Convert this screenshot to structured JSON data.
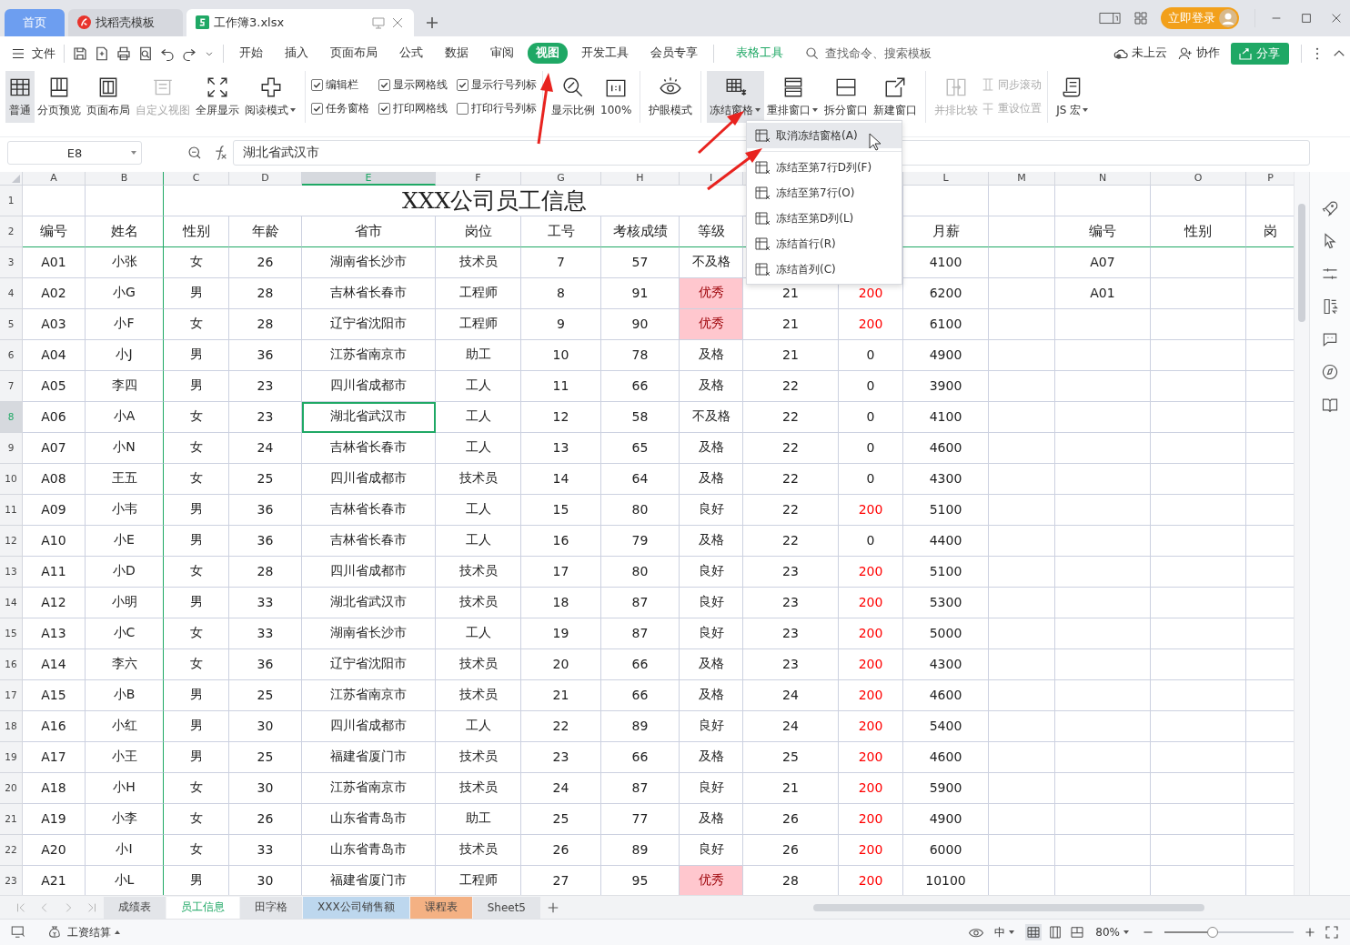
{
  "top_tabs": [
    {
      "label": "首页",
      "kind": "home",
      "selected": false
    },
    {
      "label": "找稻壳模板",
      "kind": "docer",
      "selected": false
    },
    {
      "label": "工作簿3.xlsx",
      "kind": "sheet",
      "selected": true
    }
  ],
  "login": "立即登录",
  "file_menu": "文件",
  "menu_tabs": [
    {
      "label": "开始",
      "selected": false
    },
    {
      "label": "插入",
      "selected": false
    },
    {
      "label": "页面布局",
      "selected": false
    },
    {
      "label": "公式",
      "selected": false
    },
    {
      "label": "数据",
      "selected": false
    },
    {
      "label": "审阅",
      "selected": false
    },
    {
      "label": "视图",
      "selected": true
    },
    {
      "label": "开发工具",
      "selected": false
    },
    {
      "label": "会员专享",
      "selected": false
    }
  ],
  "context_tab": "表格工具",
  "search": {
    "placeholder": "查找命令、搜索模板"
  },
  "cloud": "未上云",
  "collab": "协作",
  "share": "分享",
  "ribbon_groups": [
    [
      {
        "kind": "large",
        "label": "普通",
        "selected": true,
        "disabled": false,
        "dropdown": false
      },
      {
        "kind": "large",
        "label": "分页预览",
        "selected": false,
        "disabled": false,
        "dropdown": false
      },
      {
        "kind": "large",
        "label": "页面布局",
        "selected": false,
        "disabled": false,
        "dropdown": false
      },
      {
        "kind": "large",
        "label": "自定义视图",
        "selected": false,
        "disabled": true,
        "dropdown": false
      },
      {
        "kind": "large",
        "label": "全屏显示",
        "selected": false,
        "disabled": false,
        "dropdown": false
      },
      {
        "kind": "large",
        "label": "阅读模式",
        "selected": false,
        "disabled": false,
        "dropdown": true
      }
    ],
    [
      {
        "kind": "check",
        "label": "编辑栏",
        "checked": true
      },
      {
        "kind": "check",
        "label": "任务窗格",
        "checked": true
      },
      {
        "kind": "check",
        "label": "显示网格线",
        "checked": true
      },
      {
        "kind": "check",
        "label": "打印网格线",
        "checked": true
      },
      {
        "kind": "check",
        "label": "显示行号列标",
        "checked": true
      },
      {
        "kind": "check",
        "label": "打印行号列标",
        "checked": false
      }
    ],
    [
      {
        "kind": "large",
        "label": "显示比例",
        "selected": false,
        "disabled": false,
        "dropdown": false
      },
      {
        "kind": "large",
        "label": "100%",
        "selected": false,
        "disabled": false,
        "dropdown": false
      }
    ],
    [
      {
        "kind": "large",
        "label": "护眼模式",
        "selected": false,
        "disabled": false,
        "dropdown": false
      }
    ],
    [
      {
        "kind": "large",
        "label": "冻结窗格",
        "selected": true,
        "disabled": false,
        "dropdown": true
      },
      {
        "kind": "large",
        "label": "重排窗口",
        "selected": false,
        "disabled": false,
        "dropdown": true
      },
      {
        "kind": "large",
        "label": "拆分窗口",
        "selected": false,
        "disabled": false,
        "dropdown": false
      },
      {
        "kind": "large",
        "label": "新建窗口",
        "selected": false,
        "disabled": false,
        "dropdown": false
      }
    ],
    [
      {
        "kind": "large",
        "label": "并排比较",
        "selected": false,
        "disabled": true,
        "dropdown": false
      },
      {
        "kind": "small",
        "label": "同步滚动",
        "disabled": true
      },
      {
        "kind": "small",
        "label": "重设位置",
        "disabled": true
      }
    ],
    [
      {
        "kind": "large",
        "label": "JS 宏",
        "selected": false,
        "disabled": false,
        "dropdown": true
      }
    ]
  ],
  "name_box": "E8",
  "formula": "湖北省武汉市",
  "columns": [
    {
      "label": "A",
      "selected": false
    },
    {
      "label": "B",
      "selected": false
    },
    {
      "label": "C",
      "selected": false
    },
    {
      "label": "D",
      "selected": false
    },
    {
      "label": "E",
      "selected": true
    },
    {
      "label": "F",
      "selected": false
    },
    {
      "label": "G",
      "selected": false
    },
    {
      "label": "H",
      "selected": false
    },
    {
      "label": "I",
      "selected": false
    },
    null,
    null,
    {
      "label": "L",
      "selected": false
    },
    {
      "label": "M",
      "selected": false
    },
    {
      "label": "N",
      "selected": false
    },
    {
      "label": "O",
      "selected": false
    },
    {
      "label": "P",
      "selected": false
    }
  ],
  "rows": [
    {
      "row": "1",
      "title": "XXX公司员工信息",
      "selected": false
    },
    {
      "row": "2",
      "selected": false,
      "cells": [
        "编号",
        "姓名",
        "性别",
        "年龄",
        "省市",
        "岗位",
        "工号",
        "考核成绩",
        "等级",
        null,
        null,
        "月薪",
        null,
        "编号",
        "性别",
        "岗"
      ]
    },
    {
      "row": "3",
      "selected": false,
      "excellent": false,
      "cells": [
        "A01",
        "小张",
        "女",
        "26",
        "湖南省长沙市",
        "技术员",
        "7",
        "57",
        "不及格",
        null,
        null,
        "4100",
        null,
        "A07"
      ]
    },
    {
      "row": "4",
      "selected": false,
      "excellent": true,
      "bonus_red": true,
      "cells": [
        "A02",
        "小G",
        "男",
        "28",
        "吉林省长春市",
        "工程师",
        "8",
        "91",
        "优秀",
        "21",
        "200",
        "6200",
        null,
        "A01"
      ]
    },
    {
      "row": "5",
      "selected": false,
      "excellent": true,
      "bonus_red": true,
      "cells": [
        "A03",
        "小F",
        "女",
        "28",
        "辽宁省沈阳市",
        "工程师",
        "9",
        "90",
        "优秀",
        "21",
        "200",
        "6100"
      ]
    },
    {
      "row": "6",
      "selected": false,
      "excellent": false,
      "bonus_red": false,
      "cells": [
        "A04",
        "小J",
        "男",
        "36",
        "江苏省南京市",
        "助工",
        "10",
        "78",
        "及格",
        "21",
        "0",
        "4900"
      ]
    },
    {
      "row": "7",
      "selected": false,
      "excellent": false,
      "bonus_red": false,
      "cells": [
        "A05",
        "李四",
        "男",
        "23",
        "四川省成都市",
        "工人",
        "11",
        "66",
        "及格",
        "22",
        "0",
        "3900"
      ]
    },
    {
      "row": "8",
      "selected": true,
      "excellent": false,
      "bonus_red": false,
      "cells": [
        "A06",
        "小A",
        "女",
        "23",
        "湖北省武汉市",
        "工人",
        "12",
        "58",
        "不及格",
        "22",
        "0",
        "4100"
      ]
    },
    {
      "row": "9",
      "selected": false,
      "excellent": false,
      "bonus_red": false,
      "cells": [
        "A07",
        "小N",
        "女",
        "24",
        "吉林省长春市",
        "工人",
        "13",
        "65",
        "及格",
        "22",
        "0",
        "4600"
      ]
    },
    {
      "row": "10",
      "selected": false,
      "excellent": false,
      "bonus_red": false,
      "cells": [
        "A08",
        "王五",
        "女",
        "25",
        "四川省成都市",
        "技术员",
        "14",
        "64",
        "及格",
        "22",
        "0",
        "4300"
      ]
    },
    {
      "row": "11",
      "selected": false,
      "excellent": false,
      "bonus_red": true,
      "cells": [
        "A09",
        "小韦",
        "男",
        "36",
        "吉林省长春市",
        "工人",
        "15",
        "80",
        "良好",
        "22",
        "200",
        "5100"
      ]
    },
    {
      "row": "12",
      "selected": false,
      "excellent": false,
      "bonus_red": false,
      "cells": [
        "A10",
        "小E",
        "男",
        "36",
        "吉林省长春市",
        "工人",
        "16",
        "79",
        "及格",
        "22",
        "0",
        "4400"
      ]
    },
    {
      "row": "13",
      "selected": false,
      "excellent": false,
      "bonus_red": true,
      "cells": [
        "A11",
        "小D",
        "女",
        "28",
        "四川省成都市",
        "技术员",
        "17",
        "80",
        "良好",
        "23",
        "200",
        "5100"
      ]
    },
    {
      "row": "14",
      "selected": false,
      "excellent": false,
      "bonus_red": true,
      "cells": [
        "A12",
        "小明",
        "男",
        "33",
        "湖北省武汉市",
        "技术员",
        "18",
        "87",
        "良好",
        "23",
        "200",
        "5300"
      ]
    },
    {
      "row": "15",
      "selected": false,
      "excellent": false,
      "bonus_red": true,
      "cells": [
        "A13",
        "小C",
        "女",
        "33",
        "湖南省长沙市",
        "工人",
        "19",
        "87",
        "良好",
        "23",
        "200",
        "5000"
      ]
    },
    {
      "row": "16",
      "selected": false,
      "excellent": false,
      "bonus_red": true,
      "cells": [
        "A14",
        "李六",
        "女",
        "36",
        "辽宁省沈阳市",
        "技术员",
        "20",
        "66",
        "及格",
        "23",
        "200",
        "4300"
      ]
    },
    {
      "row": "17",
      "selected": false,
      "excellent": false,
      "bonus_red": true,
      "cells": [
        "A15",
        "小B",
        "男",
        "25",
        "江苏省南京市",
        "技术员",
        "21",
        "66",
        "及格",
        "24",
        "200",
        "4600"
      ]
    },
    {
      "row": "18",
      "selected": false,
      "excellent": false,
      "bonus_red": true,
      "cells": [
        "A16",
        "小红",
        "男",
        "30",
        "四川省成都市",
        "工人",
        "22",
        "89",
        "良好",
        "24",
        "200",
        "5400"
      ]
    },
    {
      "row": "19",
      "selected": false,
      "excellent": false,
      "bonus_red": true,
      "cells": [
        "A17",
        "小王",
        "男",
        "25",
        "福建省厦门市",
        "技术员",
        "23",
        "66",
        "及格",
        "25",
        "200",
        "4600"
      ]
    },
    {
      "row": "20",
      "selected": false,
      "excellent": false,
      "bonus_red": true,
      "cells": [
        "A18",
        "小H",
        "女",
        "30",
        "江苏省南京市",
        "技术员",
        "24",
        "87",
        "良好",
        "21",
        "200",
        "5900"
      ]
    },
    {
      "row": "21",
      "selected": false,
      "excellent": false,
      "bonus_red": true,
      "cells": [
        "A19",
        "小李",
        "女",
        "26",
        "山东省青岛市",
        "助工",
        "25",
        "77",
        "及格",
        "26",
        "200",
        "4900"
      ]
    },
    {
      "row": "22",
      "selected": false,
      "excellent": false,
      "bonus_red": true,
      "cells": [
        "A20",
        "小I",
        "女",
        "33",
        "山东省青岛市",
        "技术员",
        "26",
        "89",
        "良好",
        "26",
        "200",
        "6000"
      ]
    },
    {
      "row": "23",
      "selected": false,
      "excellent": true,
      "bonus_red": true,
      "cells": [
        "A21",
        "小L",
        "男",
        "30",
        "福建省厦门市",
        "工程师",
        "27",
        "95",
        "优秀",
        "28",
        "200",
        "10100"
      ]
    }
  ],
  "freeze_menu": [
    {
      "label": "取消冻结窗格(A)",
      "highlighted": true
    },
    {
      "label": "冻结至第7行D列(F)",
      "highlighted": false
    },
    {
      "label": "冻结至第7行(O)",
      "highlighted": false
    },
    {
      "label": "冻结至第D列(L)",
      "highlighted": false
    },
    {
      "label": "冻结首行(R)",
      "highlighted": false
    },
    {
      "label": "冻结首列(C)",
      "highlighted": false
    }
  ],
  "sheet_tabs": [
    {
      "label": "成绩表",
      "selected": false
    },
    {
      "label": "员工信息",
      "selected": true
    },
    {
      "label": "田字格",
      "selected": false
    },
    {
      "label": "XXX公司销售额",
      "selected": false,
      "color": "#bdd7ee"
    },
    {
      "label": "课程表",
      "selected": false,
      "color": "#f4b183"
    },
    {
      "label": "Sheet5",
      "selected": false
    }
  ],
  "status": {
    "macro": "工资结算",
    "input_mode": "中",
    "zoom": "80%",
    "zoom_slider": {
      "level": 0.37
    }
  }
}
